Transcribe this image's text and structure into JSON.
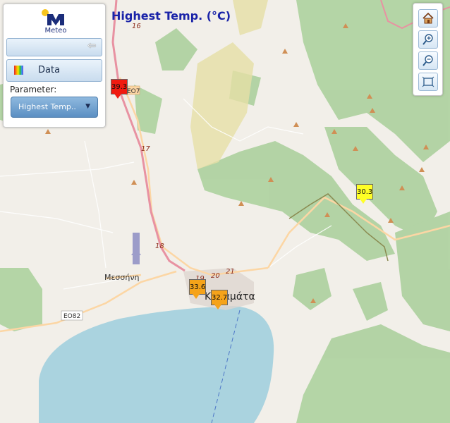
{
  "map": {
    "title": "Highest Temp. (°C)",
    "place_labels": {
      "kalamata": "Καλαμάτα",
      "messini": "Μεσσήνη"
    },
    "road_labels": {
      "r16": "16",
      "r17": "17",
      "r18": "18",
      "r19": "19",
      "r20": "20",
      "r21": "21",
      "eo7": "ΕΟ7",
      "eo82": "ΕΟ82"
    },
    "colors": {
      "land": "#f2efe9",
      "forest": "#add19e",
      "sea": "#aad3df",
      "motorway": "#e892a2",
      "road": "#fcd6a4",
      "title": "#1a23a8"
    }
  },
  "panel": {
    "logo_text": "Meteo",
    "collapse_icon": "back-arrow-icon",
    "data_button_label": "Data",
    "parameter_label": "Parameter:",
    "parameter_value": "Highest Temp.."
  },
  "toolbar": {
    "tools": [
      "home-icon",
      "zoom-in-icon",
      "zoom-out-icon",
      "full-extent-icon"
    ]
  },
  "stations": [
    {
      "id": "north-west",
      "value": "39.3",
      "color": "#f01a10"
    },
    {
      "id": "north-east",
      "value": "30.3",
      "color": "#ffff26"
    },
    {
      "id": "kalamata-west",
      "value": "33.6",
      "color": "#f5a31a"
    },
    {
      "id": "kalamata",
      "value": "32.7",
      "color": "#f5a31a"
    }
  ]
}
